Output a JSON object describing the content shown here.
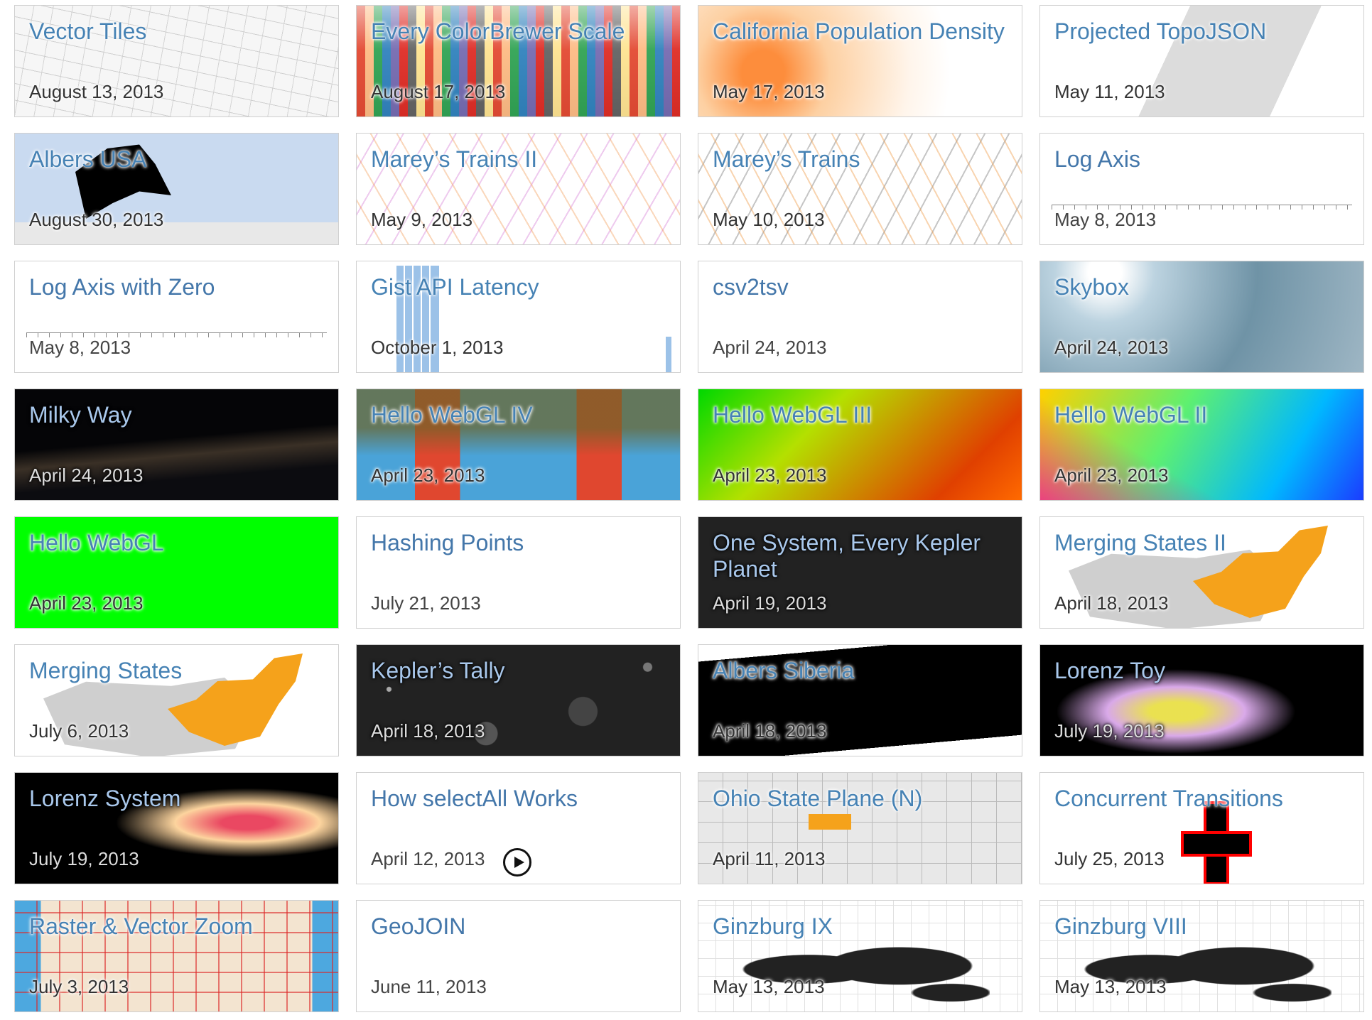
{
  "tiles": [
    {
      "title": "Vector Tiles",
      "date": "August 13, 2013"
    },
    {
      "title": "Every ColorBrewer Scale",
      "date": "August 17, 2013"
    },
    {
      "title": "California Population Density",
      "date": "May 17, 2013"
    },
    {
      "title": "Projected TopoJSON",
      "date": "May 11, 2013"
    },
    {
      "title": "Albers USA",
      "date": "August 30, 2013"
    },
    {
      "title": "Marey’s Trains II",
      "date": "May 9, 2013"
    },
    {
      "title": "Marey’s Trains",
      "date": "May 10, 2013"
    },
    {
      "title": "Log Axis",
      "date": "May 8, 2013"
    },
    {
      "title": "Log Axis with Zero",
      "date": "May 8, 2013"
    },
    {
      "title": "Gist API Latency",
      "date": "October 1, 2013"
    },
    {
      "title": "csv2tsv",
      "date": "April 24, 2013"
    },
    {
      "title": "Skybox",
      "date": "April 24, 2013"
    },
    {
      "title": "Milky Way",
      "date": "April 24, 2013"
    },
    {
      "title": "Hello WebGL IV",
      "date": "April 23, 2013"
    },
    {
      "title": "Hello WebGL III",
      "date": "April 23, 2013"
    },
    {
      "title": "Hello WebGL II",
      "date": "April 23, 2013"
    },
    {
      "title": "Hello WebGL",
      "date": "April 23, 2013"
    },
    {
      "title": "Hashing Points",
      "date": "July 21, 2013"
    },
    {
      "title": "One System, Every Kepler Planet",
      "date": "April 19, 2013"
    },
    {
      "title": "Merging States II",
      "date": "April 18, 2013"
    },
    {
      "title": "Merging States",
      "date": "July 6, 2013"
    },
    {
      "title": "Kepler’s Tally",
      "date": "April 18, 2013"
    },
    {
      "title": "Albers Siberia",
      "date": "April 18, 2013"
    },
    {
      "title": "Lorenz Toy",
      "date": "July 19, 2013"
    },
    {
      "title": "Lorenz System",
      "date": "July 19, 2013"
    },
    {
      "title": "How selectAll Works",
      "date": "April 12, 2013"
    },
    {
      "title": "Ohio State Plane (N)",
      "date": "April 11, 2013"
    },
    {
      "title": "Concurrent Transitions",
      "date": "July 25, 2013"
    },
    {
      "title": "Raster & Vector Zoom",
      "date": "July 3, 2013"
    },
    {
      "title": "GeoJOIN",
      "date": "June 11, 2013"
    },
    {
      "title": "Ginzburg IX",
      "date": "May 13, 2013"
    },
    {
      "title": "Ginzburg VIII",
      "date": "May 13, 2013"
    }
  ],
  "colors": {
    "link": "#4477aa",
    "date": "#444444",
    "border": "#d0d0d0",
    "orange_state": "#f5a21b",
    "webgl_green": "#00ff00"
  }
}
